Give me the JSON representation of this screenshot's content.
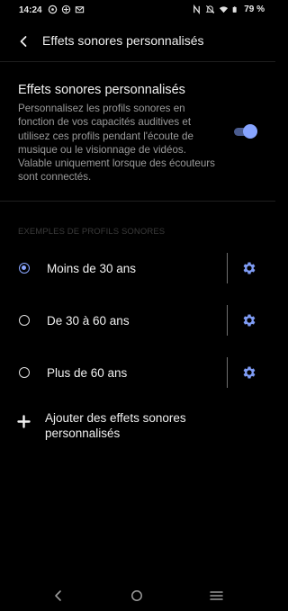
{
  "status_bar": {
    "time": "14:24",
    "battery_percent": "79 %",
    "left_icons": [
      "sync-icon",
      "share-icon",
      "mail-icon"
    ],
    "right_icons": [
      "nfc-icon",
      "mute-icon",
      "wifi-icon",
      "battery-icon"
    ]
  },
  "app_bar": {
    "title": "Effets sonores personnalisés"
  },
  "main_setting": {
    "title": "Effets sonores personnalisés",
    "description": "Personnalisez les profils sonores en fonction de vos capacités auditives et utilisez ces profils pendant l'écoute de musique ou le visionnage de vidéos. Valable uniquement lorsque des écouteurs sont connectés.",
    "enabled": true
  },
  "profiles_section": {
    "header": "EXEMPLES DE PROFILS SONORES",
    "items": [
      {
        "label": "Moins de 30 ans",
        "selected": true
      },
      {
        "label": "De 30 à 60 ans",
        "selected": false
      },
      {
        "label": "Plus de 60 ans",
        "selected": false
      }
    ]
  },
  "add_action": {
    "label": "Ajouter des effets sonores personnalisés"
  },
  "colors": {
    "accent": "#8aa6ff",
    "background": "#000000",
    "secondary_text": "#9a9a9a"
  },
  "nav_bar": {
    "icons": [
      "back-icon",
      "home-icon",
      "menu-icon"
    ]
  }
}
